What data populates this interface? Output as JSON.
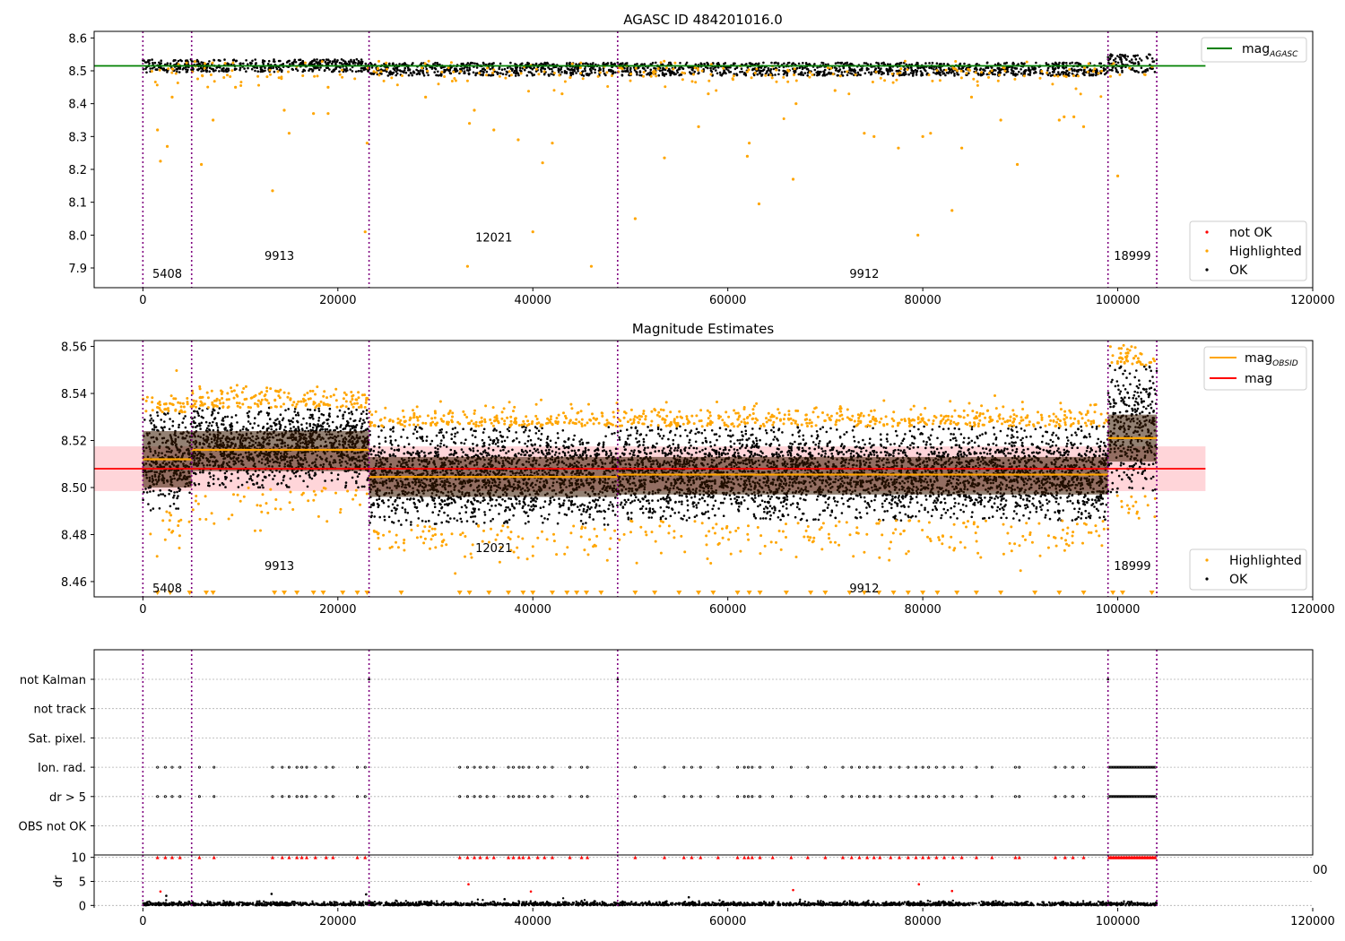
{
  "colors": {
    "ok": "#000000",
    "highlighted": "#FFA500",
    "not_ok": "#FF0000",
    "agasc_line": "#008000",
    "mag_line": "#FF0000",
    "mag_obsid": "#FFA500",
    "obs_boundary": "#800080",
    "mag_band": "#FFD0D5"
  },
  "chart_data": [
    {
      "type": "scatter",
      "title": "AGASC ID 484201016.0",
      "xlim": [
        -5000,
        120000
      ],
      "ylim": [
        7.84,
        8.62
      ],
      "xticks": [
        0,
        20000,
        40000,
        60000,
        80000,
        100000,
        120000
      ],
      "yticks": [
        7.9,
        8.0,
        8.1,
        8.2,
        8.3,
        8.4,
        8.5,
        8.6
      ],
      "ytick_labels": [
        "7.9",
        "8.0",
        "8.1",
        "8.2",
        "8.3",
        "8.4",
        "8.5",
        "8.6"
      ],
      "obs_boundaries": [
        0,
        5000,
        23200,
        48700,
        99000,
        104000
      ],
      "obs_labels": [
        {
          "text": "5408",
          "x": 2500,
          "y": 7.87
        },
        {
          "text": "9913",
          "x": 14000,
          "y": 7.925
        },
        {
          "text": "12021",
          "x": 36000,
          "y": 7.98
        },
        {
          "text": "9912",
          "x": 74000,
          "y": 7.87
        },
        {
          "text": "18999",
          "x": 101500,
          "y": 7.925
        }
      ],
      "reference_lines": [
        {
          "name": "mag_AGASC",
          "y": 8.515,
          "x": [
            -5000,
            109000
          ]
        }
      ],
      "ok_bands": [
        {
          "x": [
            0,
            5000
          ],
          "y": [
            8.495,
            8.535
          ]
        },
        {
          "x": [
            5000,
            23200
          ],
          "y": [
            8.497,
            8.535
          ]
        },
        {
          "x": [
            23200,
            48700
          ],
          "y": [
            8.485,
            8.525
          ]
        },
        {
          "x": [
            48700,
            99000
          ],
          "y": [
            8.485,
            8.525
          ]
        },
        {
          "x": [
            99000,
            104000
          ],
          "y": [
            8.495,
            8.55
          ]
        }
      ],
      "highlighted_points": [
        [
          1500,
          8.32
        ],
        [
          1800,
          8.225
        ],
        [
          2500,
          8.27
        ],
        [
          6000,
          8.215
        ],
        [
          7200,
          8.35
        ],
        [
          13300,
          8.135
        ],
        [
          15000,
          8.31
        ],
        [
          14500,
          8.38
        ],
        [
          17500,
          8.37
        ],
        [
          19000,
          8.37
        ],
        [
          22800,
          8.01
        ],
        [
          23000,
          8.28
        ],
        [
          33500,
          8.34
        ],
        [
          33300,
          7.905
        ],
        [
          34000,
          8.38
        ],
        [
          36000,
          8.32
        ],
        [
          38500,
          8.29
        ],
        [
          40000,
          8.01
        ],
        [
          41000,
          8.22
        ],
        [
          42000,
          8.28
        ],
        [
          46000,
          7.905
        ],
        [
          50500,
          8.05
        ],
        [
          53500,
          8.235
        ],
        [
          57000,
          8.33
        ],
        [
          62000,
          8.24
        ],
        [
          62200,
          8.28
        ],
        [
          63200,
          8.095
        ],
        [
          66700,
          8.17
        ],
        [
          74000,
          8.31
        ],
        [
          75000,
          8.3
        ],
        [
          77500,
          8.265
        ],
        [
          79500,
          8.0
        ],
        [
          80000,
          8.3
        ],
        [
          80800,
          8.31
        ],
        [
          83000,
          8.075
        ],
        [
          84000,
          8.265
        ],
        [
          89700,
          8.215
        ],
        [
          94000,
          8.35
        ],
        [
          94500,
          8.36
        ],
        [
          95500,
          8.36
        ],
        [
          96500,
          8.33
        ],
        [
          100000,
          8.18
        ],
        [
          3000,
          8.42
        ],
        [
          9500,
          8.45
        ],
        [
          19000,
          8.45
        ],
        [
          29000,
          8.42
        ],
        [
          43000,
          8.43
        ],
        [
          58000,
          8.43
        ],
        [
          67000,
          8.4
        ],
        [
          71000,
          8.44
        ],
        [
          85000,
          8.42
        ],
        [
          88000,
          8.35
        ]
      ],
      "legends": [
        {
          "position": "top-right",
          "items": [
            {
              "label": "mag",
              "sub": "AGASC",
              "marker": "line",
              "color_key": "agasc_line"
            }
          ]
        },
        {
          "position": "bottom-right",
          "items": [
            {
              "label": "not OK",
              "marker": "dot",
              "color_key": "not_ok"
            },
            {
              "label": "Highlighted",
              "marker": "dot",
              "color_key": "highlighted"
            },
            {
              "label": "OK",
              "marker": "dot",
              "color_key": "ok"
            }
          ]
        }
      ]
    },
    {
      "type": "scatter",
      "title": "Magnitude Estimates",
      "xlim": [
        -5000,
        120000
      ],
      "ylim": [
        8.4535,
        8.5625
      ],
      "xticks": [
        0,
        20000,
        40000,
        60000,
        80000,
        100000,
        120000
      ],
      "yticks": [
        8.46,
        8.48,
        8.5,
        8.52,
        8.54,
        8.56
      ],
      "ytick_labels": [
        "8.46",
        "8.48",
        "8.50",
        "8.52",
        "8.54",
        "8.56"
      ],
      "obs_boundaries": [
        0,
        5000,
        23200,
        48700,
        99000,
        104000
      ],
      "obs_labels": [
        {
          "text": "5408",
          "x": 2500,
          "y": 8.4555
        },
        {
          "text": "9913",
          "x": 14000,
          "y": 8.465
        },
        {
          "text": "12021",
          "x": 36000,
          "y": 8.4725
        },
        {
          "text": "9912",
          "x": 74000,
          "y": 8.4555
        },
        {
          "text": "18999",
          "x": 101500,
          "y": 8.465
        }
      ],
      "mag": {
        "y": 8.508,
        "band": [
          8.4985,
          8.5175
        ],
        "x": [
          -5000,
          109000
        ]
      },
      "obs_segments": [
        {
          "x": [
            0,
            5000
          ],
          "mag_obsid": 8.512,
          "ok_range": [
            8.49,
            8.532
          ],
          "dark_band": [
            8.5,
            8.524
          ]
        },
        {
          "x": [
            5000,
            23200
          ],
          "mag_obsid": 8.516,
          "ok_range": [
            8.5,
            8.534
          ],
          "dark_band": [
            8.507,
            8.524
          ]
        },
        {
          "x": [
            23200,
            48700
          ],
          "mag_obsid": 8.5045,
          "ok_range": [
            8.484,
            8.526
          ],
          "dark_band": [
            8.496,
            8.513
          ]
        },
        {
          "x": [
            48700,
            99000
          ],
          "mag_obsid": 8.5055,
          "ok_range": [
            8.486,
            8.526
          ],
          "dark_band": [
            8.497,
            8.513
          ]
        },
        {
          "x": [
            99000,
            104000
          ],
          "mag_obsid": 8.521,
          "ok_range": [
            8.498,
            8.552
          ],
          "dark_band": [
            8.511,
            8.531
          ]
        }
      ],
      "below_axis_x": [
        1500,
        2800,
        4800,
        6500,
        7200,
        13500,
        14500,
        15800,
        17500,
        18500,
        20500,
        22000,
        23000,
        26500,
        32500,
        33500,
        35500,
        37500,
        39000,
        40000,
        42000,
        43500,
        44500,
        45500,
        47000,
        50500,
        52500,
        55000,
        57000,
        58500,
        61000,
        62200,
        63300,
        66000,
        68500,
        70000,
        72500,
        74000,
        75500,
        77000,
        78500,
        80000,
        81500,
        83500,
        85500,
        88000,
        91500,
        94000,
        96500,
        99500,
        100500,
        103500
      ],
      "legends": [
        {
          "position": "top-right",
          "items": [
            {
              "label": "mag",
              "sub": "OBSID",
              "marker": "line",
              "color_key": "mag_obsid"
            },
            {
              "label": "mag",
              "marker": "line",
              "color_key": "mag_line"
            }
          ]
        },
        {
          "position": "bottom-right",
          "items": [
            {
              "label": "Highlighted",
              "marker": "dot",
              "color_key": "highlighted"
            },
            {
              "label": "OK",
              "marker": "dot",
              "color_key": "ok"
            }
          ]
        }
      ]
    },
    {
      "type": "scatter",
      "title": "",
      "xlim": [
        -5000,
        120000
      ],
      "flag_rows": [
        "not Kalman",
        "not track",
        "Sat. pixel.",
        "Ion. rad.",
        "dr > 5",
        "OBS not OK"
      ],
      "obs_boundaries": [
        0,
        5000,
        23200,
        48700,
        99000,
        104000
      ],
      "flag_events_x": [
        1500,
        2300,
        3000,
        3800,
        5800,
        7300,
        13300,
        14300,
        15000,
        15800,
        16300,
        16800,
        17700,
        18800,
        19500,
        22000,
        22800,
        32500,
        33300,
        34000,
        34600,
        35300,
        36000,
        37500,
        38000,
        38600,
        39000,
        39600,
        40500,
        41200,
        42000,
        43800,
        45000,
        45600,
        50500,
        53500,
        55500,
        56300,
        57200,
        59000,
        61000,
        61700,
        62100,
        62500,
        63300,
        64600,
        66500,
        68200,
        70000,
        71800,
        72700,
        73500,
        74300,
        75000,
        75600,
        76700,
        77600,
        78500,
        79300,
        80000,
        80600,
        81400,
        82200,
        83100,
        84000,
        85500,
        87100,
        89500,
        89900,
        93600,
        94600,
        95400,
        96500
      ],
      "kalman_events_x": [
        23200,
        48700,
        99000
      ],
      "dr_subplot": {
        "ylabel": "dr",
        "ylim": [
          -0.5,
          10.5
        ],
        "yticks": [
          0,
          5,
          10
        ],
        "ytick_labels": [
          "0",
          "5",
          "10"
        ],
        "clipped_x": [
          1500,
          2300,
          3000,
          3800,
          5800,
          7300,
          13300,
          14300,
          15000,
          15800,
          16300,
          16800,
          17700,
          18800,
          19500,
          22000,
          22800,
          32500,
          33300,
          34000,
          34600,
          35300,
          36000,
          37500,
          38000,
          38600,
          39000,
          39600,
          40500,
          41200,
          42000,
          43800,
          45000,
          45600,
          50500,
          53500,
          55500,
          56300,
          57200,
          59000,
          61000,
          61700,
          62100,
          62500,
          63300,
          64600,
          66500,
          68200,
          70000,
          71800,
          72700,
          73500,
          74300,
          75000,
          75600,
          76700,
          77600,
          78500,
          79300,
          80000,
          80600,
          81400,
          82200,
          83100,
          84000,
          85500,
          87100,
          89500,
          89900,
          93600,
          94600,
          95400,
          96500
        ],
        "red_points": [
          [
            1800,
            2.9
          ],
          [
            33400,
            4.4
          ],
          [
            39800,
            2.9
          ],
          [
            66700,
            3.2
          ],
          [
            79600,
            4.4
          ],
          [
            83000,
            3.0
          ]
        ],
        "black_points": [
          [
            2400,
            2.0
          ],
          [
            13200,
            2.4
          ],
          [
            22900,
            2.3
          ],
          [
            37100,
            1.3
          ],
          [
            56000,
            1.7
          ]
        ]
      },
      "overflow_tick_label": "00"
    }
  ],
  "seeds": {
    "scatter": 7
  }
}
